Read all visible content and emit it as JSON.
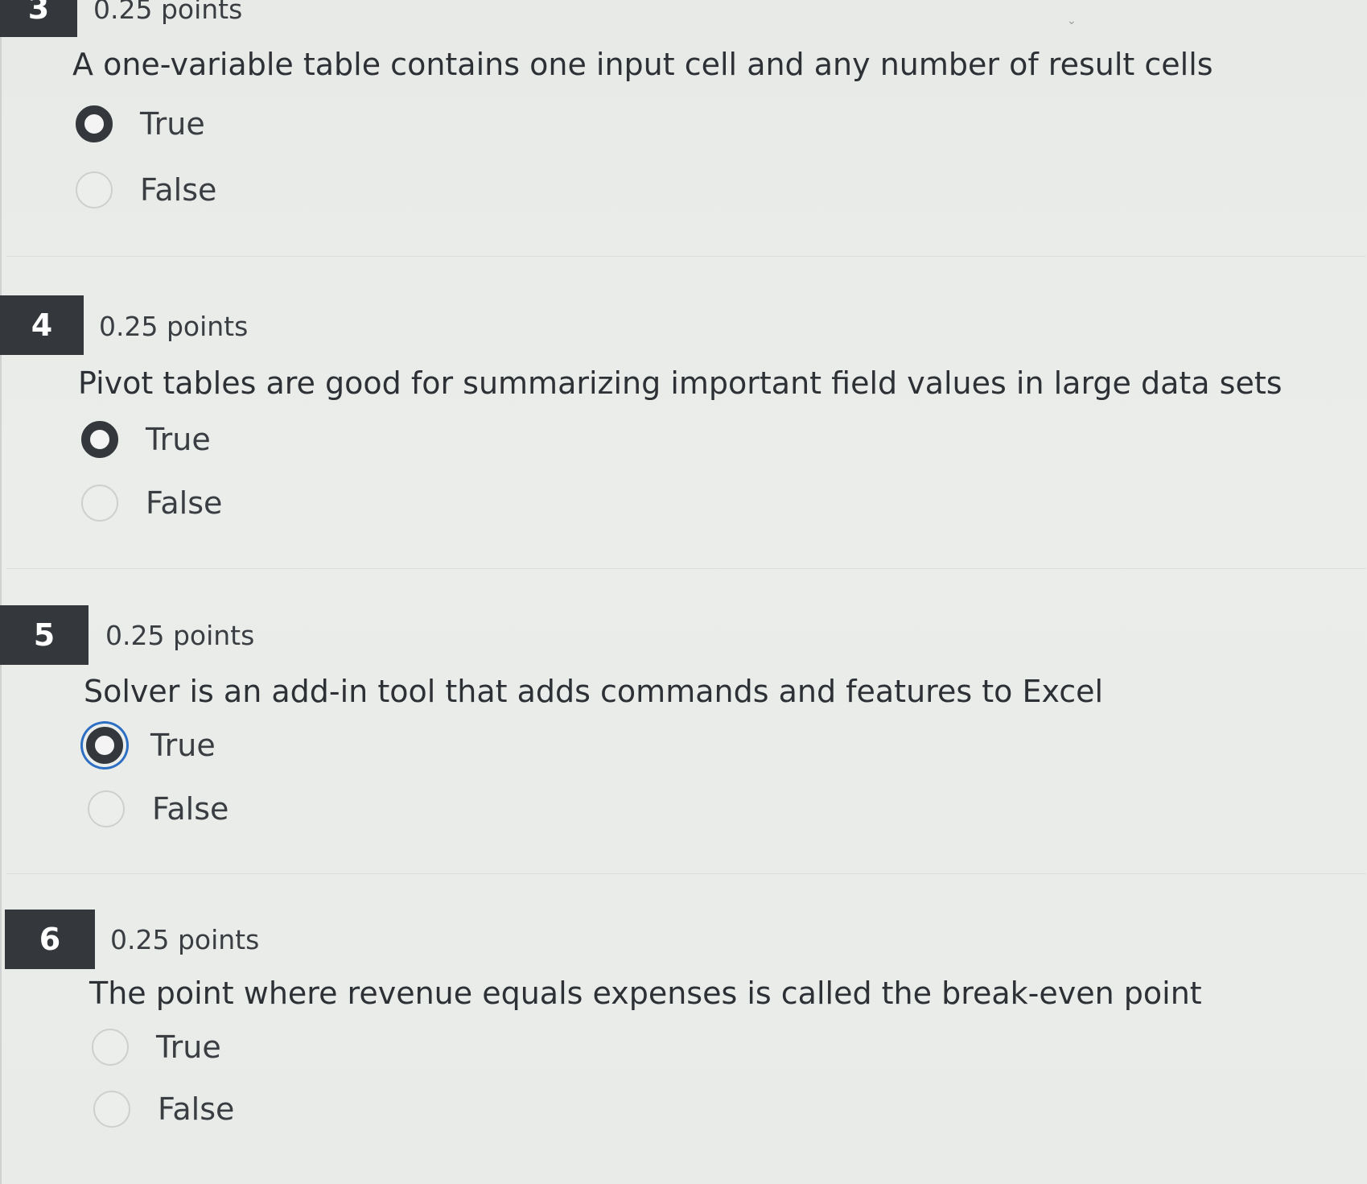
{
  "questions": [
    {
      "number": "3",
      "points": "0.25 points",
      "text": "A one-variable table contains one input cell and any number of result cells",
      "options": [
        {
          "label": "True",
          "selected": true
        },
        {
          "label": "False",
          "selected": false
        }
      ]
    },
    {
      "number": "4",
      "points": "0.25 points",
      "text": "Pivot tables are good for summarizing important field values in large data sets",
      "options": [
        {
          "label": "True",
          "selected": true
        },
        {
          "label": "False",
          "selected": false
        }
      ]
    },
    {
      "number": "5",
      "points": "0.25 points",
      "text": "Solver is an add-in tool that adds commands and features to Excel",
      "options": [
        {
          "label": "True",
          "selected": true
        },
        {
          "label": "False",
          "selected": false
        }
      ]
    },
    {
      "number": "6",
      "points": "0.25 points",
      "text": "The point where  revenue equals expenses is called the break-even point",
      "options": [
        {
          "label": "True",
          "selected": false
        },
        {
          "label": "False",
          "selected": false
        }
      ]
    }
  ],
  "colors": {
    "number_badge": "#34383c",
    "focus_ring": "#2e6fc4",
    "background": "#e9ebe9"
  }
}
